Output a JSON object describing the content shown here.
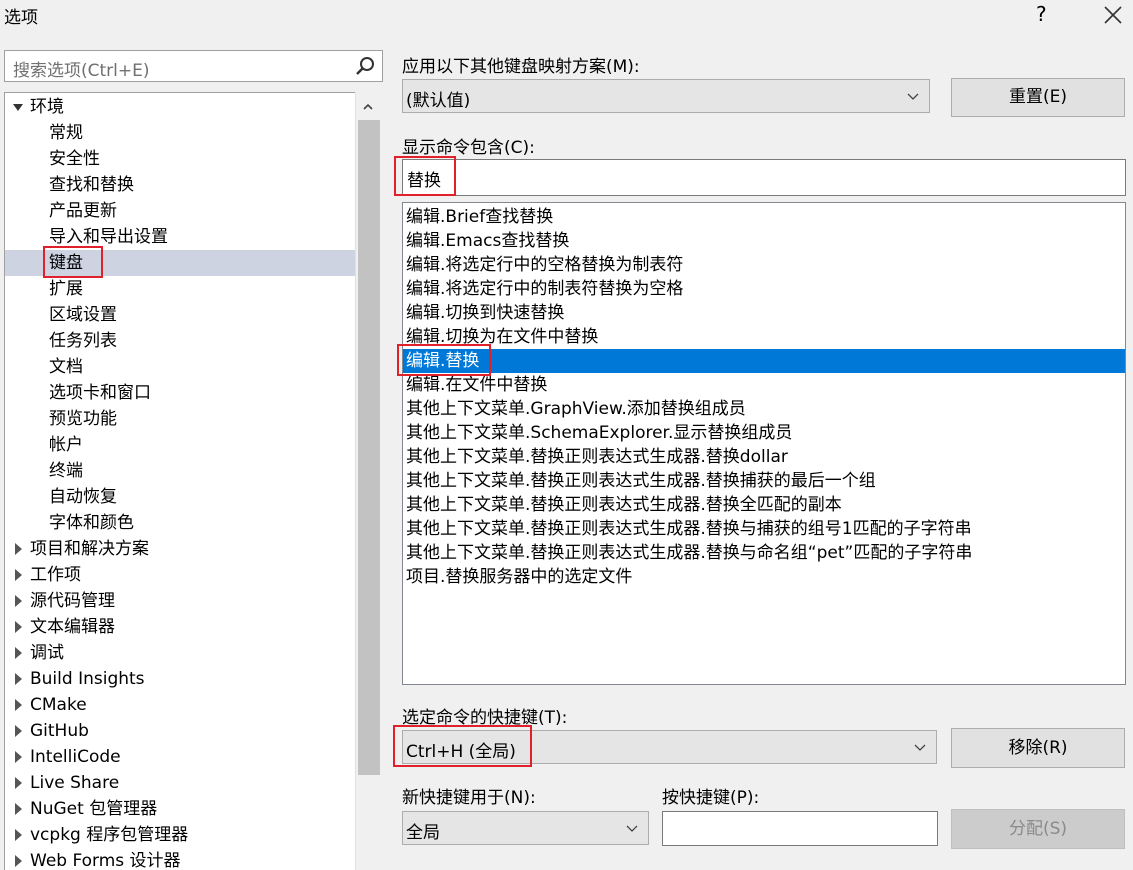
{
  "window": {
    "title": "选项",
    "help": "?"
  },
  "search": {
    "placeholder": "搜索选项(Ctrl+E)"
  },
  "tree": {
    "environment": "环境",
    "env_children": [
      "常规",
      "安全性",
      "查找和替换",
      "产品更新",
      "导入和导出设置",
      "键盘",
      "扩展",
      "区域设置",
      "任务列表",
      "文档",
      "选项卡和窗口",
      "预览功能",
      "帐户",
      "终端",
      "自动恢复",
      "字体和颜色"
    ],
    "selected": "键盘",
    "top_items": [
      "项目和解决方案",
      "工作项",
      "源代码管理",
      "文本编辑器",
      "调试",
      "Build Insights",
      "CMake",
      "GitHub",
      "IntelliCode",
      "Live Share",
      "NuGet 包管理器",
      "vcpkg 程序包管理器",
      "Web Forms 设计器"
    ]
  },
  "mapping": {
    "label": "应用以下其他键盘映射方案(M):",
    "value": "(默认值)",
    "reset_button": "重置(E)"
  },
  "filter": {
    "label": "显示命令包含(C):",
    "value": "替换"
  },
  "commands": {
    "items": [
      "编辑.Brief查找替换",
      "编辑.Emacs查找替换",
      "编辑.将选定行中的空格替换为制表符",
      "编辑.将选定行中的制表符替换为空格",
      "编辑.切换到快速替换",
      "编辑.切换为在文件中替换",
      "编辑.替换",
      "编辑.在文件中替换",
      "其他上下文菜单.GraphView.添加替换组成员",
      "其他上下文菜单.SchemaExplorer.显示替换组成员",
      "其他上下文菜单.替换正则表达式生成器.替换dollar",
      "其他上下文菜单.替换正则表达式生成器.替换捕获的最后一个组",
      "其他上下文菜单.替换正则表达式生成器.替换全匹配的副本",
      "其他上下文菜单.替换正则表达式生成器.替换与捕获的组号1匹配的子字符串",
      "其他上下文菜单.替换正则表达式生成器.替换与命名组“pet”匹配的子字符串",
      "项目.替换服务器中的选定文件"
    ],
    "selected_index": 6
  },
  "shortcuts": {
    "label": "选定命令的快捷键(T):",
    "value": "Ctrl+H (全局)",
    "remove_button": "移除(R)"
  },
  "newshortcut": {
    "scope_label": "新快捷键用于(N):",
    "scope_value": "全局",
    "press_label": "按快捷键(P):",
    "assign_button": "分配(S)"
  },
  "colors": {
    "selection": "#0078d7",
    "tree_selection": "#cdd3e0",
    "highlight_box": "#e0202a"
  }
}
